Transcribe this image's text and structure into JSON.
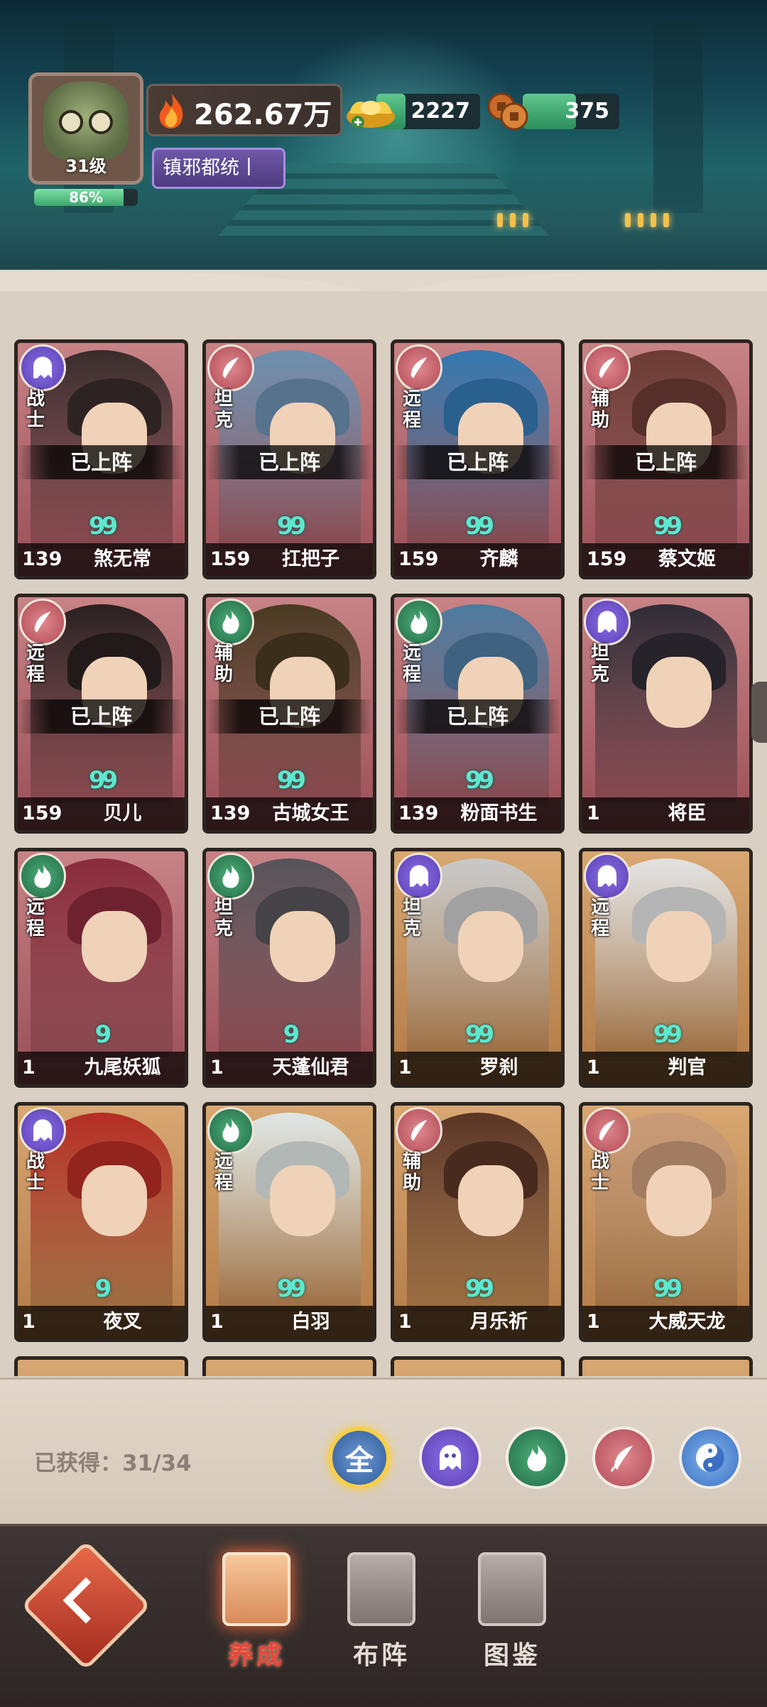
{
  "header": {
    "player_level": "31级",
    "exp_percent": "86%",
    "exp_fraction": 0.86,
    "power": "262.67万",
    "title_badge": "镇邪都统丨",
    "ingot": "2227",
    "ingot_fill": 0.28,
    "coins": "375",
    "coins_fill": 0.55
  },
  "cards": [
    {
      "role": "战士",
      "element": "purple",
      "deployed": "已上阵",
      "tier": "99",
      "level": "139",
      "name": "煞无常",
      "frame": "red",
      "palette": "#3a2c2c"
    },
    {
      "role": "坦克",
      "element": "pink",
      "deployed": "已上阵",
      "tier": "99",
      "level": "159",
      "name": "扛把子",
      "frame": "red",
      "palette": "#6c8fb0"
    },
    {
      "role": "远程",
      "element": "pink",
      "deployed": "已上阵",
      "tier": "99",
      "level": "159",
      "name": "齐麟",
      "frame": "red",
      "palette": "#3478b0"
    },
    {
      "role": "辅助",
      "element": "pink",
      "deployed": "已上阵",
      "tier": "99",
      "level": "159",
      "name": "蔡文姬",
      "frame": "red",
      "palette": "#6b3b34"
    },
    {
      "role": "远程",
      "element": "pink",
      "deployed": "已上阵",
      "tier": "99",
      "level": "159",
      "name": "贝儿",
      "frame": "red",
      "palette": "#2a2020"
    },
    {
      "role": "辅助",
      "element": "green",
      "deployed": "已上阵",
      "tier": "99",
      "level": "139",
      "name": "古城女王",
      "frame": "red",
      "palette": "#4a3a22"
    },
    {
      "role": "远程",
      "element": "green",
      "deployed": "已上阵",
      "tier": "99",
      "level": "139",
      "name": "粉面书生",
      "frame": "red",
      "palette": "#4d7aa0"
    },
    {
      "role": "坦克",
      "element": "purple",
      "deployed": "",
      "tier": "",
      "level": "1",
      "name": "将臣",
      "frame": "red",
      "palette": "#2f2c36"
    },
    {
      "role": "远程",
      "element": "green",
      "deployed": "",
      "tier": "9",
      "level": "1",
      "name": "九尾妖狐",
      "frame": "red",
      "palette": "#8a2b3c"
    },
    {
      "role": "坦克",
      "element": "green",
      "deployed": "",
      "tier": "9",
      "level": "1",
      "name": "天蓬仙君",
      "frame": "red",
      "palette": "#56535a"
    },
    {
      "role": "坦克",
      "element": "purple",
      "deployed": "",
      "tier": "99",
      "level": "1",
      "name": "罗刹",
      "frame": "gold",
      "palette": "#c9c9c9"
    },
    {
      "role": "远程",
      "element": "purple",
      "deployed": "",
      "tier": "99",
      "level": "1",
      "name": "判官",
      "frame": "gold",
      "palette": "#e2e2e2"
    },
    {
      "role": "战士",
      "element": "purple",
      "deployed": "",
      "tier": "9",
      "level": "1",
      "name": "夜叉",
      "frame": "gold",
      "palette": "#b52d24"
    },
    {
      "role": "远程",
      "element": "green",
      "deployed": "",
      "tier": "99",
      "level": "1",
      "name": "白羽",
      "frame": "gold",
      "palette": "#dfe6e4"
    },
    {
      "role": "辅助",
      "element": "pink",
      "deployed": "",
      "tier": "99",
      "level": "1",
      "name": "月乐祈",
      "frame": "gold",
      "palette": "#5a3526"
    },
    {
      "role": "战士",
      "element": "pink",
      "deployed": "",
      "tier": "99",
      "level": "1",
      "name": "大威天龙",
      "frame": "gold",
      "palette": "#c99b78"
    }
  ],
  "panel": {
    "owned": "已获得：31/34",
    "filter_all": "全"
  },
  "nav": {
    "tab1": "养成",
    "tab2": "布阵",
    "tab3": "图鉴"
  },
  "colors": {
    "accent_red": "#e8463a",
    "deployed_bg": "#000000",
    "tier_cyan": "#5ee6cf"
  }
}
